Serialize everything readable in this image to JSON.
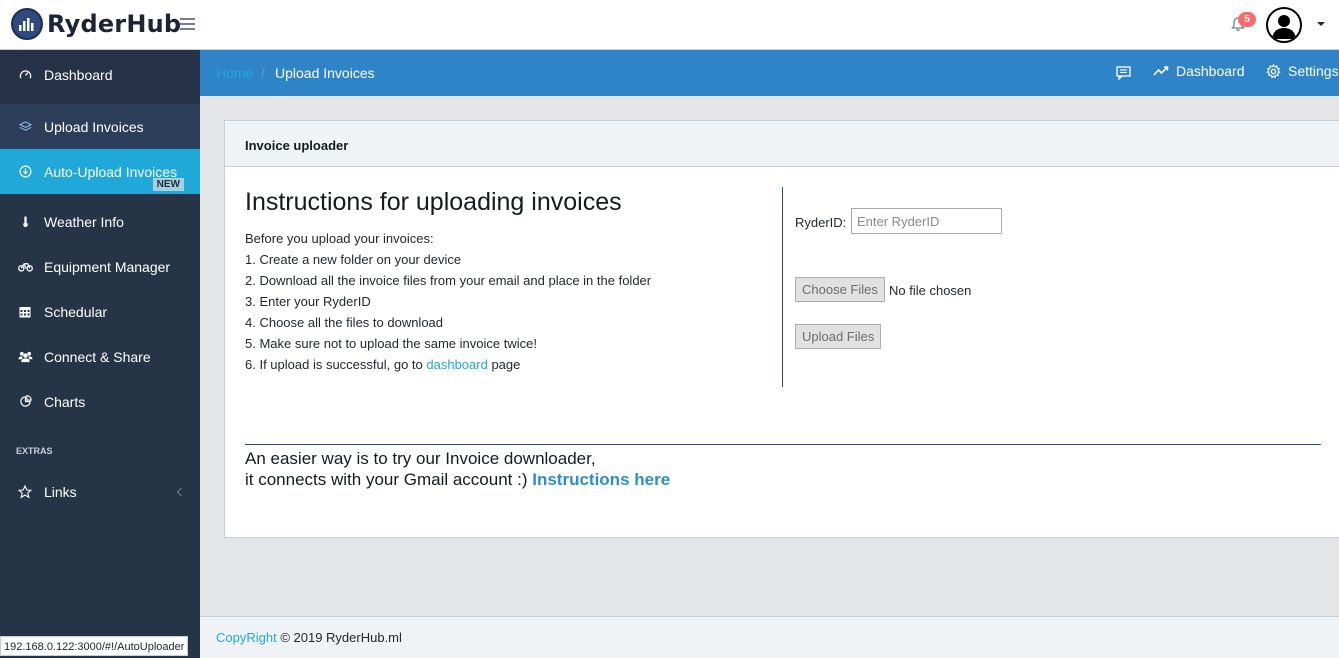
{
  "brand": {
    "name": "RyderHub"
  },
  "header": {
    "notification_count": "5"
  },
  "sidebar": {
    "items": [
      {
        "label": "Dashboard",
        "icon": "speedometer-icon"
      },
      {
        "label": "Upload Invoices",
        "icon": "layers-icon"
      },
      {
        "label": "Auto-Upload Invoices",
        "icon": "download-circle-icon",
        "badge": "NEW"
      },
      {
        "label": "Weather Info",
        "icon": "thermometer-icon"
      },
      {
        "label": "Equipment Manager",
        "icon": "bicycle-icon"
      },
      {
        "label": "Schedular",
        "icon": "calendar-icon"
      },
      {
        "label": "Connect & Share",
        "icon": "users-icon"
      },
      {
        "label": "Charts",
        "icon": "pie-chart-icon"
      }
    ],
    "extras_title": "EXTRAS",
    "extras_items": [
      {
        "label": "Links",
        "icon": "star-icon"
      }
    ]
  },
  "breadcrumb": {
    "home": "Home",
    "separator": "/",
    "current": "Upload Invoices",
    "menu": {
      "dashboard": "Dashboard",
      "settings": "Settings"
    }
  },
  "card": {
    "title": "Invoice uploader",
    "heading": "Instructions for uploading invoices",
    "intro": "Before you upload your invoices:",
    "steps": [
      "1. Create a new folder on your device",
      "2. Download all the invoice files from your email and place in the folder",
      "3. Enter your RyderID",
      "4. Choose all the files to download",
      "5. Make sure not to upload the same invoice twice!"
    ],
    "step6_prefix": "6. If upload is successful, go to ",
    "step6_link": "dashboard",
    "step6_suffix": " page",
    "form": {
      "ryderid_label": "RyderID:",
      "ryderid_placeholder": "Enter RyderID",
      "ryderid_value": "",
      "choose_files": "Choose Files",
      "no_file": "No file chosen",
      "upload_files": "Upload Files"
    },
    "easier_line1": "An easier way is to try our Invoice downloader,",
    "easier_line2": "it connects with your Gmail account :) ",
    "easier_link": "Instructions here"
  },
  "footer": {
    "link": "CopyRight",
    "text": " © 2019 RyderHub.ml"
  },
  "status_bar": {
    "url": "192.168.0.122:3000/#!/AutoUploader"
  },
  "colors": {
    "sidebar": "#263448",
    "active": "#20a8d8",
    "breadcrumb_bar": "#2e84c6",
    "badge": "#f86c6b"
  }
}
